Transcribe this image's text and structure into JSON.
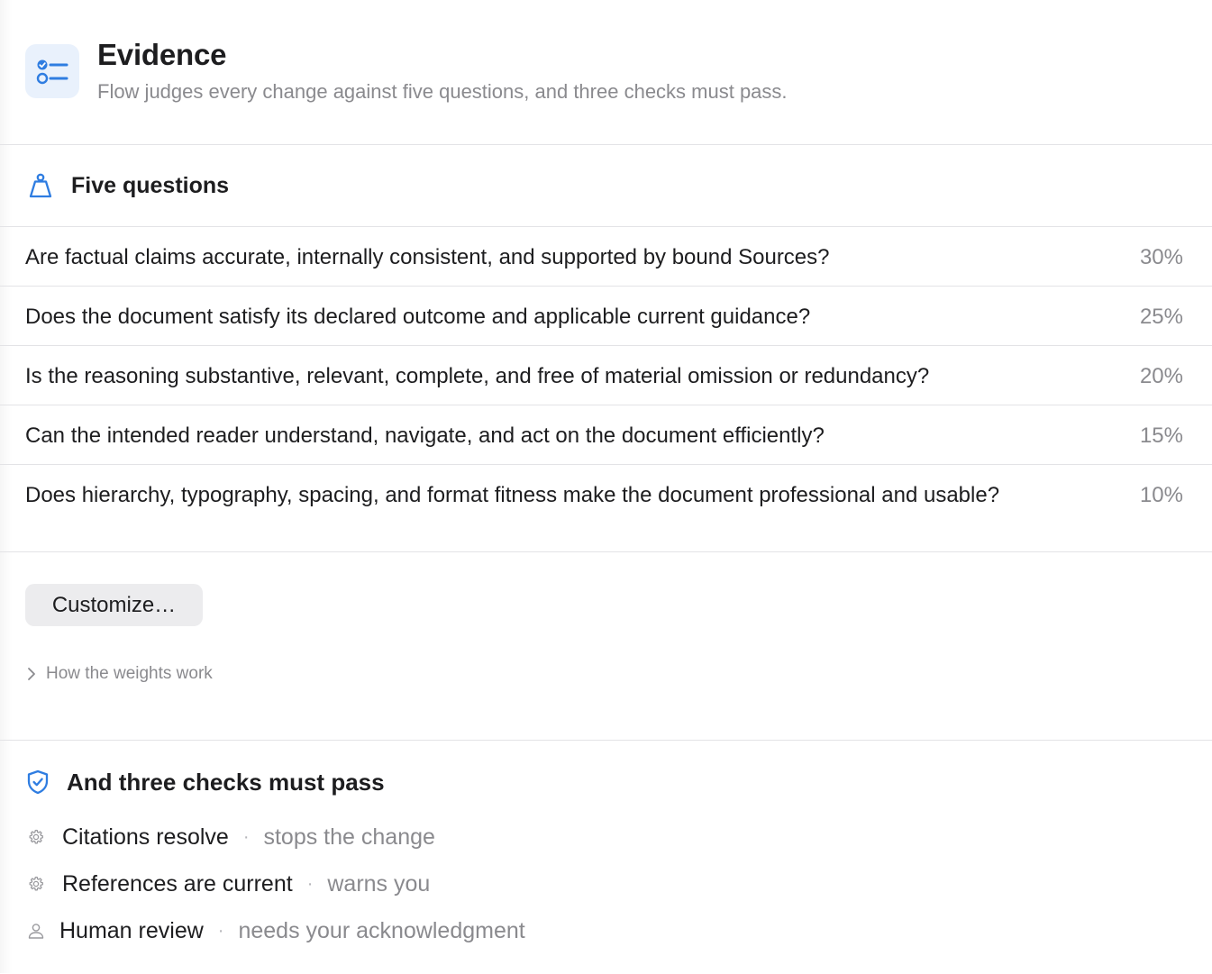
{
  "header": {
    "title": "Evidence",
    "subtitle": "Flow judges every change against five questions, and three checks must pass.",
    "icon": "checklist-icon",
    "accent_color": "#2f7de1"
  },
  "five_questions": {
    "title": "Five questions",
    "icon": "scale-weight-icon",
    "items": [
      {
        "question": "Are factual claims accurate, internally consistent, and supported by bound Sources?",
        "weight": "30%"
      },
      {
        "question": "Does the document satisfy its declared outcome and applicable current guidance?",
        "weight": "25%"
      },
      {
        "question": "Is the reasoning substantive, relevant, complete, and free of material omission or redundancy?",
        "weight": "20%"
      },
      {
        "question": "Can the intended reader understand, navigate, and act on the document efficiently?",
        "weight": "15%"
      },
      {
        "question": "Does hierarchy, typography, spacing, and format fitness make the document professional and usable?",
        "weight": "10%"
      }
    ],
    "customize_label": "Customize…",
    "weights_disclosure_label": "How the weights work"
  },
  "checks": {
    "title": "And three checks must pass",
    "icon": "shield-check-icon",
    "separator": "·",
    "items": [
      {
        "name": "Citations resolve",
        "effect": "stops the change",
        "icon": "gear-icon"
      },
      {
        "name": "References are current",
        "effect": "warns you",
        "icon": "gear-icon"
      },
      {
        "name": "Human review",
        "effect": "needs your acknowledgment",
        "icon": "person-icon"
      }
    ]
  }
}
